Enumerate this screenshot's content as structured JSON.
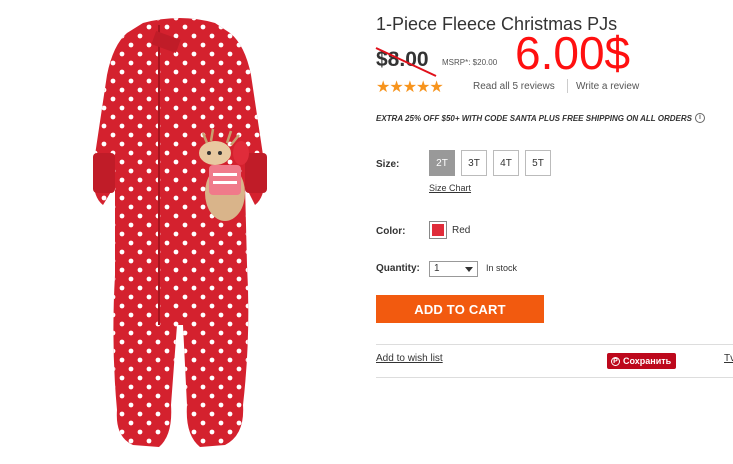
{
  "product": {
    "title": "1-Piece Fleece Christmas PJs",
    "old_price": "$8.00",
    "msrp": "MSRP*: $20.00",
    "new_price": "6.00$",
    "rating_stars": "★★★★★",
    "reviews_link": "Read all 5 reviews",
    "write_review": "Write a review",
    "promo": "EXTRA 25% OFF $50+ WITH CODE SANTA PLUS FREE SHIPPING ON ALL ORDERS"
  },
  "size": {
    "label": "Size:",
    "options": [
      "2T",
      "3T",
      "4T",
      "5T"
    ],
    "selected": "2T",
    "chart_link": "Size Chart"
  },
  "color": {
    "label": "Color:",
    "value": "Red",
    "swatch_hex": "#e02c3a"
  },
  "quantity": {
    "label": "Quantity:",
    "value": "1",
    "stock": "In stock"
  },
  "actions": {
    "add_to_cart": "ADD TO CART",
    "wish_list": "Add to wish list",
    "pin_label": "Сохранить",
    "tw_label": "Tv"
  },
  "colors": {
    "cart_button": "#f25a0f",
    "price_overlay": "#ff1010",
    "stars": "#f7941d",
    "pin": "#bd081c"
  }
}
